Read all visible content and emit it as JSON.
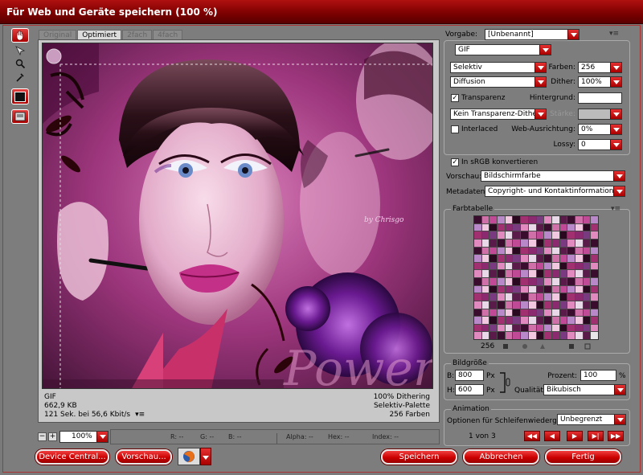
{
  "window": {
    "title": "Für Web und Geräte speichern (100 %)"
  },
  "tabs": [
    {
      "label": "Original",
      "active": false
    },
    {
      "label": "Optimiert",
      "active": true
    },
    {
      "label": "2fach",
      "active": false
    },
    {
      "label": "4fach",
      "active": false
    }
  ],
  "tools": [
    "hand-tool",
    "slice-select-tool",
    "zoom-tool",
    "eyedropper-tool",
    "eyedropper-color",
    "toggle-slices"
  ],
  "image_info": {
    "format": "GIF",
    "size": "662,9 KB",
    "time": "121 Sek. bei 56,6 Kbit/s",
    "dither": "100% Dithering",
    "palette": "Selektiv-Palette",
    "colors": "256 Farben"
  },
  "image_text": {
    "watermark": "Power",
    "signature": "by Chrisgo"
  },
  "zoom": {
    "minus": "−",
    "plus": "+",
    "value": "100%"
  },
  "readout": {
    "r": "R: --",
    "g": "G: --",
    "b": "B: --",
    "alpha": "Alpha: --",
    "hex": "Hex: --",
    "index": "Index: --"
  },
  "buttons": {
    "device_central": "Device Central...",
    "preview": "Vorschau...",
    "save": "Speichern",
    "cancel": "Abbrechen",
    "done": "Fertig"
  },
  "settings": {
    "preset_label": "Vorgabe:",
    "preset_value": "[Unbenannt]",
    "format_value": "GIF",
    "reduction_value": "Selektiv",
    "colors_label": "Farben:",
    "colors_value": "256",
    "dither_algo_value": "Diffusion",
    "dither_label": "Dither:",
    "dither_value": "100%",
    "transparency_label": "Transparenz",
    "transparency_checked": true,
    "matte_label": "Hintergrund:",
    "transp_dither_value": "Kein Transparenz-Dither",
    "amount_label": "Stärke:",
    "interlaced_label": "Interlaced",
    "interlaced_checked": false,
    "websnap_label": "Web-Ausrichtung:",
    "websnap_value": "0%",
    "lossy_label": "Lossy:",
    "lossy_value": "0",
    "srgb_label": "In sRGB konvertieren",
    "srgb_checked": true,
    "preview_label": "Vorschau:",
    "preview_value": "Bildschirmfarbe",
    "metadata_label": "Metadaten:",
    "metadata_value": "Copyright- und Kontaktinformationen",
    "check_mark": "✓"
  },
  "color_table": {
    "label": "Farbtabelle",
    "count": "256",
    "accent_colors": [
      "#3a0d2e",
      "#8b2a6e",
      "#c04a95",
      "#e08ac0",
      "#f2c8e0",
      "#5a1a4a",
      "#a03070",
      "#d070a8",
      "#7a3a80",
      "#b888c8",
      "#e8d8e8",
      "#2a0820"
    ]
  },
  "image_size": {
    "label": "Bildgröße",
    "w_label": "B:",
    "w_value": "800",
    "h_label": "H:",
    "h_value": "600",
    "unit": "Px",
    "percent_label": "Prozent:",
    "percent_value": "100",
    "percent_unit": "%",
    "quality_label": "Qualität:",
    "quality_value": "Bikubisch"
  },
  "animation": {
    "label": "Animation",
    "loop_label": "Optionen für Schleifenwiedergabe:",
    "loop_value": "Unbegrenzt",
    "frame_counter": "1 von 3",
    "controls": [
      "first-frame",
      "previous-frame",
      "play",
      "next-frame",
      "last-frame"
    ],
    "control_glyphs": [
      "◀◀",
      "◀",
      "▶",
      "▶|",
      "▶▶"
    ]
  },
  "menu_glyph": "▾≡"
}
